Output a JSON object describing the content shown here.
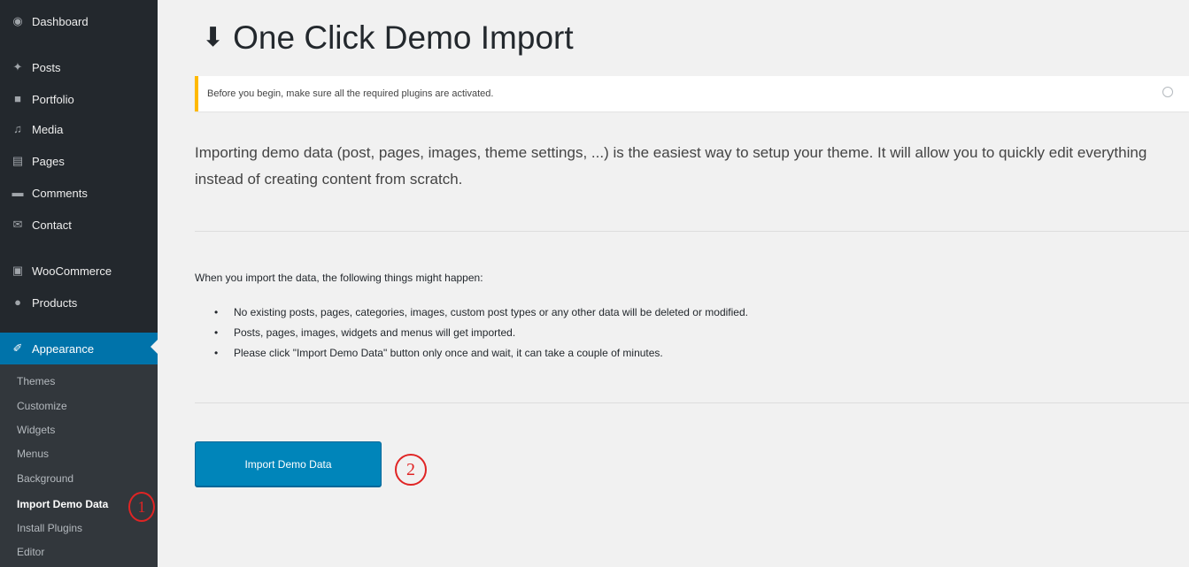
{
  "sidebar": {
    "items": [
      {
        "label": "Dashboard",
        "icon": "dashboard-icon"
      },
      {
        "label": "Posts",
        "icon": "pin-icon"
      },
      {
        "label": "Portfolio",
        "icon": "portfolio-icon"
      },
      {
        "label": "Media",
        "icon": "media-icon"
      },
      {
        "label": "Pages",
        "icon": "pages-icon"
      },
      {
        "label": "Comments",
        "icon": "comments-icon"
      },
      {
        "label": "Contact",
        "icon": "mail-icon"
      },
      {
        "label": "WooCommerce",
        "icon": "woocommerce-icon"
      },
      {
        "label": "Products",
        "icon": "products-icon"
      },
      {
        "label": "Appearance",
        "icon": "brush-icon"
      }
    ],
    "submenu": [
      "Themes",
      "Customize",
      "Widgets",
      "Menus",
      "Background",
      "Import Demo Data",
      "Install Plugins",
      "Editor"
    ],
    "current_submenu": "Import Demo Data",
    "accent_color": "#0073aa"
  },
  "annotations": {
    "step1": "1",
    "step2": "2",
    "color": "#e02424"
  },
  "main": {
    "title": "One Click Demo Import",
    "title_icon": "download-icon",
    "notice": "Before you begin, make sure all the required plugins are activated.",
    "notice_border_color": "#ffb900",
    "intro": "Importing demo data (post, pages, images, theme settings, ...) is the easiest way to setup your theme. It will allow you to quickly edit everything instead of creating content from scratch.",
    "warning_heading": "When you import the data, the following things might happen:",
    "warnings": [
      "No existing posts, pages, categories, images, custom post types or any other data will be deleted or modified.",
      "Posts, pages, images, widgets and menus will get imported.",
      "Please click \"Import Demo Data\" button only once and wait, it can take a couple of minutes."
    ],
    "import_button": "Import Demo Data",
    "button_color": "#0085ba"
  }
}
